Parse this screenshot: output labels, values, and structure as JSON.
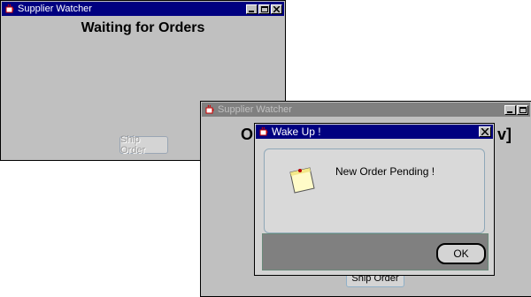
{
  "window1": {
    "title": "Supplier Watcher",
    "heading": "Waiting for Orders",
    "button": "Ship Order"
  },
  "window2": {
    "title": "Supplier Watcher",
    "heading_left": "O",
    "heading_right": "v]",
    "button": "Ship Order"
  },
  "dialog": {
    "title": "Wake Up !",
    "message": "New Order Pending !",
    "ok": "OK",
    "icon": "note-icon"
  },
  "colors": {
    "title_active": "#000080",
    "title_inactive": "#808080",
    "window_bg": "#c0c0c0",
    "dialog_footer": "#808080"
  }
}
